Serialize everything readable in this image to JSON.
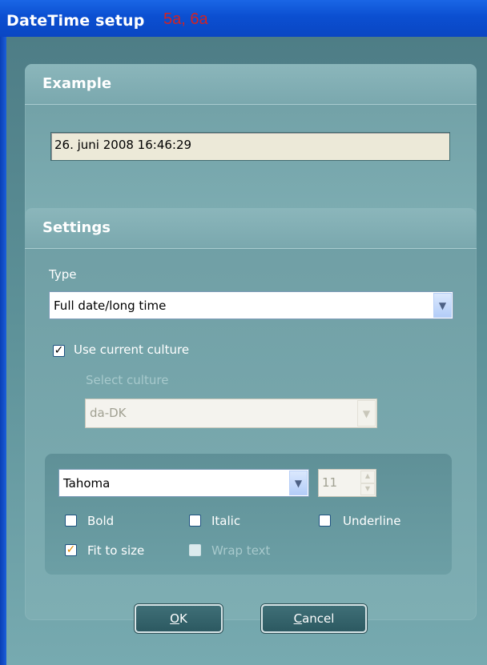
{
  "window": {
    "title": "DateTime setup",
    "title_extra": "5a, 6a"
  },
  "example": {
    "header": "Example",
    "value": "26. juni 2008 16:46:29"
  },
  "settings": {
    "header": "Settings",
    "type_label": "Type",
    "type_value": "Full date/long time",
    "use_current_culture_label": "Use current culture",
    "use_current_culture_checked": true,
    "select_culture_label": "Select culture",
    "culture_value": "da-DK"
  },
  "font": {
    "family": "Tahoma",
    "size": "11",
    "bold_label": "Bold",
    "bold_checked": false,
    "italic_label": "Italic",
    "italic_checked": false,
    "underline_label": "Underline",
    "underline_checked": false,
    "fit_label": "Fit to size",
    "fit_checked": true,
    "wrap_label": "Wrap text",
    "wrap_checked": false
  },
  "buttons": {
    "ok_mnemonic": "O",
    "ok_rest": "K",
    "cancel_mnemonic": "C",
    "cancel_rest": "ancel"
  },
  "icons": {
    "dropdown": "chevron-down-icon",
    "checkmark": "check-icon"
  },
  "colors": {
    "titlebar": "#0b4fd1",
    "panel": "#7aa8ae",
    "title_extra": "#d22323"
  }
}
